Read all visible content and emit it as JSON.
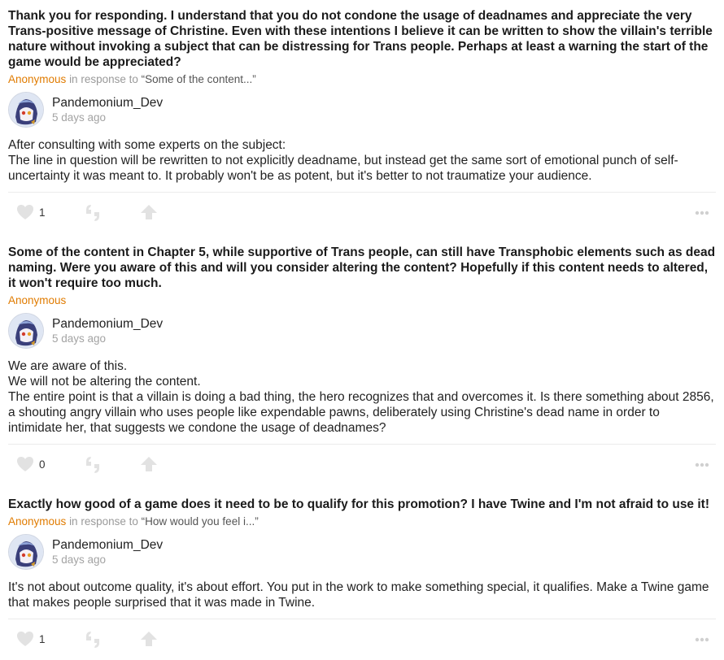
{
  "posts": [
    {
      "question": "Thank you for responding. I understand that you do not condone the usage of deadnames and appreciate the very Trans-positive message of Christine. Even with these intentions I believe it can be written to show the villain's terrible nature without invoking a subject that can be distressing for Trans people. Perhaps at least a warning the start of the game would be appreciated?",
      "author": "Anonymous",
      "in_response_to": "in response to",
      "quote": "“Some of the content...”",
      "responder": "Pandemonium_Dev",
      "time": "5 days ago",
      "answer": [
        "After consulting with some experts on the subject:",
        "The line in question will be rewritten to not explicitly deadname, but instead get the same sort of emotional punch of self-uncertainty it was meant to. It probably won't be as potent, but it's better to not traumatize your audience."
      ],
      "likes": "1"
    },
    {
      "question": "Some of the content in Chapter 5, while supportive of Trans people, can still have Transphobic elements such as dead naming. Were you aware of this and will you consider altering the content? Hopefully if this content needs to altered, it won't require too much.",
      "author": "Anonymous",
      "responder": "Pandemonium_Dev",
      "time": "5 days ago",
      "answer": [
        "We are aware of this.",
        "We will not be altering the content.",
        "The entire point is that a villain is doing a bad thing, the hero recognizes that and overcomes it. Is there something about 2856, a shouting angry villain who uses people like expendable pawns, deliberately using Christine's dead name in order to intimidate her, that suggests we condone the usage of deadnames?"
      ],
      "likes": "0"
    },
    {
      "question": "Exactly how good of a game does it need to be to qualify for this promotion? I have Twine and I'm not afraid to use it!",
      "author": "Anonymous",
      "in_response_to": "in response to",
      "quote": "“How would you feel i...”",
      "responder": "Pandemonium_Dev",
      "time": "5 days ago",
      "answer": [
        "It's not about outcome quality, it's about effort. You put in the work to make something special, it qualifies. Make a Twine game that makes people surprised that it was made in Twine."
      ],
      "likes": "1"
    }
  ],
  "icons": {
    "like": "heart-icon",
    "ask": "quote-icon",
    "share": "upvote-arrow-icon",
    "more": "more-dots-icon"
  },
  "colors": {
    "author": "#e07b00",
    "muted": "#a3a3a3",
    "icon": "#e2e2e2"
  }
}
